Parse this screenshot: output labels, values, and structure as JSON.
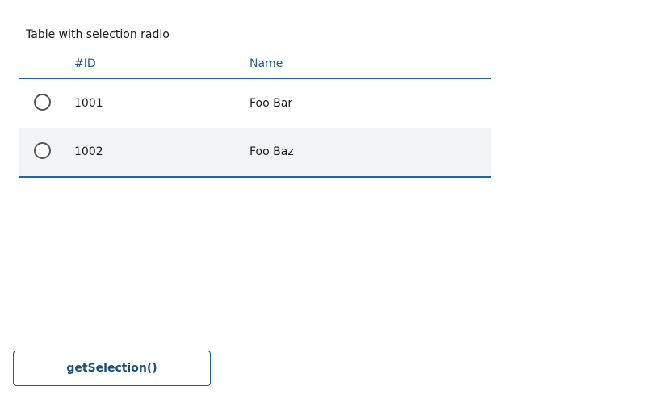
{
  "caption": "Table with selection radio",
  "table": {
    "headers": {
      "id": "#ID",
      "name": "Name"
    },
    "rows": [
      {
        "id": "1001",
        "name": "Foo Bar",
        "selected": false
      },
      {
        "id": "1002",
        "name": "Foo Baz",
        "selected": false
      }
    ]
  },
  "button": {
    "label": "getSelection()"
  },
  "colors": {
    "accent": "#1b6aa5",
    "header_text": "#1b5e8f",
    "alt_row": "#f2f3f4"
  }
}
